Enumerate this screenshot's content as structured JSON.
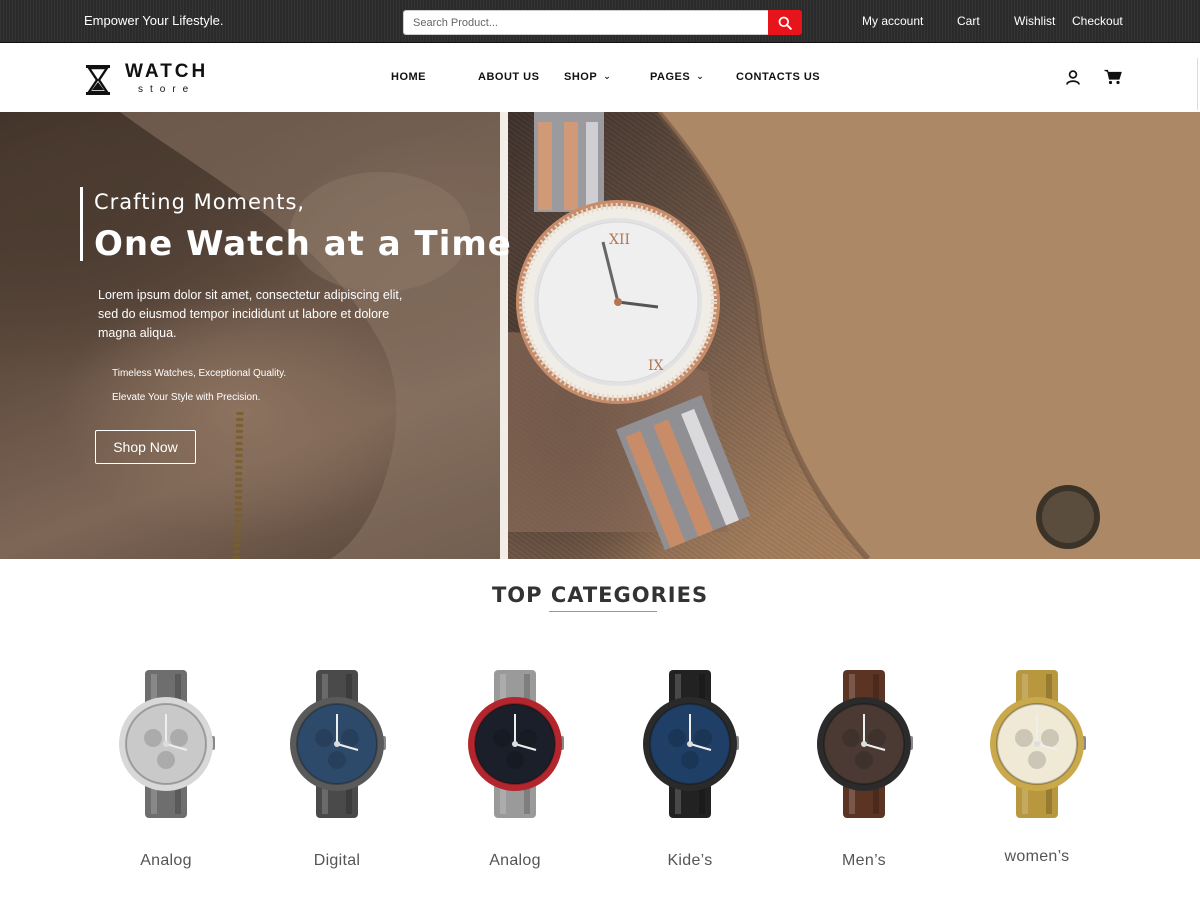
{
  "topbar": {
    "tagline": "Empower Your Lifestyle.",
    "search": {
      "placeholder": "Search Product...",
      "value": ""
    },
    "links": [
      "My account",
      "Cart",
      "Wishlist",
      "Checkout"
    ]
  },
  "header": {
    "logo_title": "WATCH",
    "logo_subtitle": "store",
    "nav": [
      {
        "label": "HOME",
        "has_dropdown": false
      },
      {
        "label": "ABOUT US",
        "has_dropdown": false
      },
      {
        "label": "SHOP",
        "has_dropdown": true
      },
      {
        "label": "PAGES",
        "has_dropdown": true
      },
      {
        "label": "CONTACTS US",
        "has_dropdown": false
      }
    ],
    "icons": [
      "user-icon",
      "cart-icon"
    ]
  },
  "hero": {
    "kicker": "Crafting Moments,",
    "title": "One Watch at a Time",
    "description": "Lorem ipsum dolor sit amet, consectetur adipiscing elit, sed do eiusmod tempor incididunt ut labore et dolore magna aliqua.",
    "points": [
      "Timeless Watches, Exceptional Quality.",
      "Elevate Your Style with Precision."
    ],
    "button": "Shop Now"
  },
  "categories": {
    "heading": "TOP CATEGORIES",
    "items": [
      {
        "label": "Analog",
        "dial": "#c9c9c9",
        "strap": "#6e6e6e",
        "bezel": "#d8d8d8"
      },
      {
        "label": "Digital",
        "dial": "#2e4a6a",
        "strap": "#4a4a4a",
        "bezel": "#5a5a5a"
      },
      {
        "label": "Analog",
        "dial": "#1b1f2a",
        "strap": "#9a9a9a",
        "bezel": "#b3262d"
      },
      {
        "label": "Kide’s",
        "dial": "#1f3f66",
        "strap": "#222222",
        "bezel": "#2a2a2a"
      },
      {
        "label": "Men’s",
        "dial": "#4a3a33",
        "strap": "#5b3424",
        "bezel": "#2b2b2b"
      },
      {
        "label": "women’s",
        "dial": "#efe9d6",
        "strap": "#b8973e",
        "bezel": "#c9a94c"
      }
    ]
  },
  "colors": {
    "accent": "#e8141b",
    "topbar": "#2b2b2b"
  }
}
